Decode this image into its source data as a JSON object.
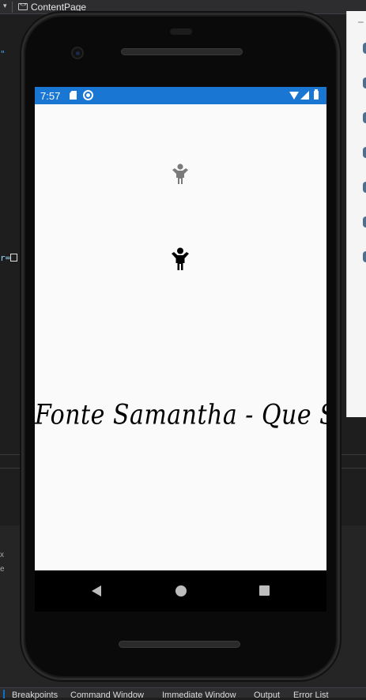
{
  "ide": {
    "document_tab": "ContentPage",
    "status_tabs": [
      "Breakpoints",
      "Command Window",
      "Immediate Window",
      "Output",
      "Error List"
    ]
  },
  "device": {
    "status_bar": {
      "time": "7:57",
      "color": "#1976d2"
    },
    "content": {
      "icons": [
        "person-icon-gray",
        "person-icon-black"
      ],
      "label": "Fonte Samantha - Que Show !"
    },
    "nav": [
      "back",
      "home",
      "recent-apps"
    ]
  }
}
